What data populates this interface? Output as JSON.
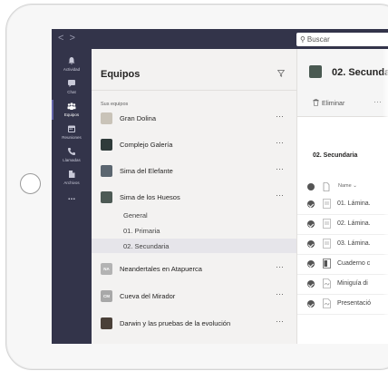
{
  "topbar": {
    "nav_back": "<",
    "nav_forward": ">",
    "search_placeholder": "Buscar"
  },
  "rail": {
    "items": [
      {
        "label": "Actividad",
        "icon": "bell-icon"
      },
      {
        "label": "Chat",
        "icon": "chat-icon"
      },
      {
        "label": "Equipos",
        "icon": "teams-icon",
        "active": true
      },
      {
        "label": "Reuniones",
        "icon": "calendar-icon"
      },
      {
        "label": "Llamadas",
        "icon": "phone-icon"
      },
      {
        "label": "Archivos",
        "icon": "files-icon"
      },
      {
        "label": "...",
        "icon": "more-icon"
      }
    ]
  },
  "panel": {
    "title": "Equipos",
    "section_label": "Sus equipos",
    "more_label": "···",
    "teams": [
      {
        "name": "Gran Dolina",
        "avatar_color": "#c9c3b8",
        "initials": ""
      },
      {
        "name": "Complejo Galería",
        "avatar_color": "#2f3b3a",
        "initials": ""
      },
      {
        "name": "Sima del Elefante",
        "avatar_color": "#5b6670",
        "initials": ""
      },
      {
        "name": "Sima de los Huesos",
        "avatar_color": "#4d5a55",
        "initials": ""
      },
      {
        "name": "Neandertales en Atapuerca",
        "avatar_color": "#b3b3b3",
        "initials": "NA"
      },
      {
        "name": "Cueva del Mirador",
        "avatar_color": "#a8a8a8",
        "initials": "CM"
      },
      {
        "name": "Darwin y las pruebas de la evolución",
        "avatar_color": "#4a4038",
        "initials": ""
      }
    ],
    "channels": [
      {
        "name": "General"
      },
      {
        "name": "01. Primaria"
      },
      {
        "name": "02. Secundaria",
        "selected": true
      }
    ]
  },
  "main": {
    "title": "02. Secunda",
    "delete_label": "Eliminar",
    "toolbar_more": "···",
    "breadcrumb": "02. Secundaria",
    "column_name": "Name ⌄",
    "files": [
      {
        "name": "01. Lámina.",
        "type": "doc"
      },
      {
        "name": "02. Lámina.",
        "type": "doc"
      },
      {
        "name": "03. Lámina.",
        "type": "doc"
      },
      {
        "name": "Cuaderno c",
        "type": "notebook"
      },
      {
        "name": "Miniguía di",
        "type": "pdf"
      },
      {
        "name": "Presentació",
        "type": "pdf"
      }
    ]
  },
  "colors": {
    "rail_bg": "#33344a",
    "accent": "#6264a7",
    "panel_bg": "#f3f2f1"
  }
}
